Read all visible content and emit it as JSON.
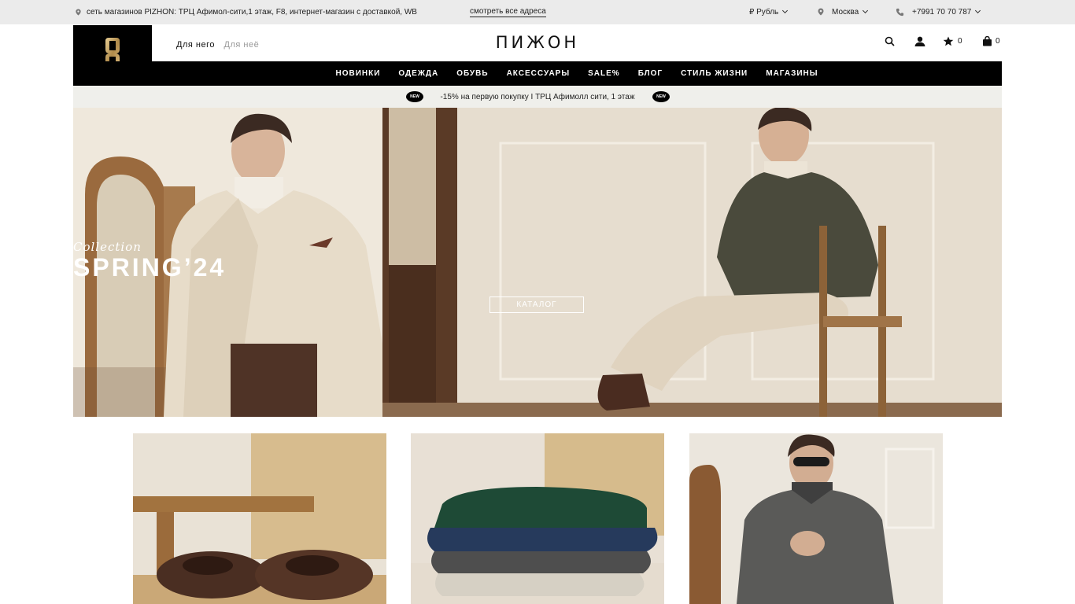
{
  "topbar": {
    "address": "сеть магазинов PIZHON: ТРЦ Афимол-сити,1 этаж, F8, интернет-магазин с доставкой, WB",
    "all_addresses": "смотреть все адреса",
    "currency": "₽ Рубль",
    "city": "Москва",
    "phone": "+7991 70 70 787"
  },
  "header": {
    "brand": "ПИЖОН",
    "for_him": "Для него",
    "for_her": "Для неё",
    "favorites_count": "0",
    "cart_count": "0"
  },
  "nav": {
    "items": [
      "НОВИНКИ",
      "ОДЕЖДА",
      "ОБУВЬ",
      "АКСЕССУАРЫ",
      "SALE%",
      "БЛОГ",
      "СТИЛЬ ЖИЗНИ",
      "МАГАЗИНЫ"
    ]
  },
  "promo": {
    "text": "-15% на первую покупку I ТРЦ Афимолл сити, 1 этаж",
    "badge": "NEW"
  },
  "hero": {
    "collection": "Collection",
    "season": "SPRING’24",
    "cta": "КАТАЛОГ"
  },
  "colors": {
    "black": "#000000",
    "topbar_bg": "#ebebeb",
    "promo_bg": "#efefeb",
    "logo_gold": "#c9a86a"
  }
}
